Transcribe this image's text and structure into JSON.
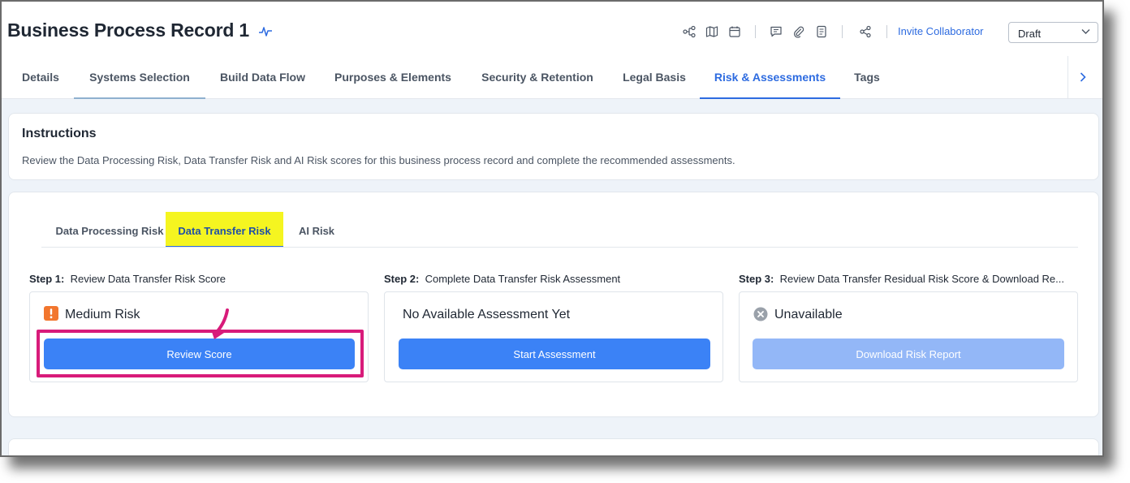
{
  "header": {
    "title": "Business Process Record 1",
    "invite_label": "Invite Collaborator",
    "status_value": "Draft"
  },
  "tabs": [
    {
      "label": "Details"
    },
    {
      "label": "Systems Selection"
    },
    {
      "label": "Build Data Flow"
    },
    {
      "label": "Purposes & Elements"
    },
    {
      "label": "Security & Retention"
    },
    {
      "label": "Legal Basis"
    },
    {
      "label": "Risk & Assessments"
    },
    {
      "label": "Tags"
    }
  ],
  "instructions": {
    "title": "Instructions",
    "text": "Review the Data Processing Risk, Data Transfer Risk and AI Risk scores for this business process record and complete the recommended assessments."
  },
  "risk_tabs": [
    {
      "label": "Data Processing Risk"
    },
    {
      "label": "Data Transfer Risk"
    },
    {
      "label": "AI Risk"
    }
  ],
  "steps": [
    {
      "step": "Step 1:",
      "label": "Review Data Transfer Risk Score",
      "status": "Medium Risk",
      "button": "Review Score"
    },
    {
      "step": "Step 2:",
      "label": "Complete Data Transfer Risk Assessment",
      "status": "No Available Assessment Yet",
      "button": "Start Assessment"
    },
    {
      "step": "Step 3:",
      "label": "Review Data Transfer Residual Risk Score & Download Re...",
      "status": "Unavailable",
      "button": "Download Risk Report"
    }
  ],
  "colors": {
    "accent": "#2d6be0",
    "button": "#3b82f6",
    "button_disabled": "#93b7f7",
    "highlight": "#f5f520",
    "annotation": "#d81b7a",
    "warning": "#f2762e",
    "unavailable": "#9aa1aa"
  },
  "icons": [
    "pulse-icon",
    "workflow-icon",
    "map-icon",
    "calendar-icon",
    "comment-icon",
    "paperclip-icon",
    "notes-icon",
    "share-icon",
    "chevron-down-icon",
    "chevron-right-icon",
    "warning-icon",
    "x-circle-icon",
    "arrow-annotation-icon"
  ]
}
